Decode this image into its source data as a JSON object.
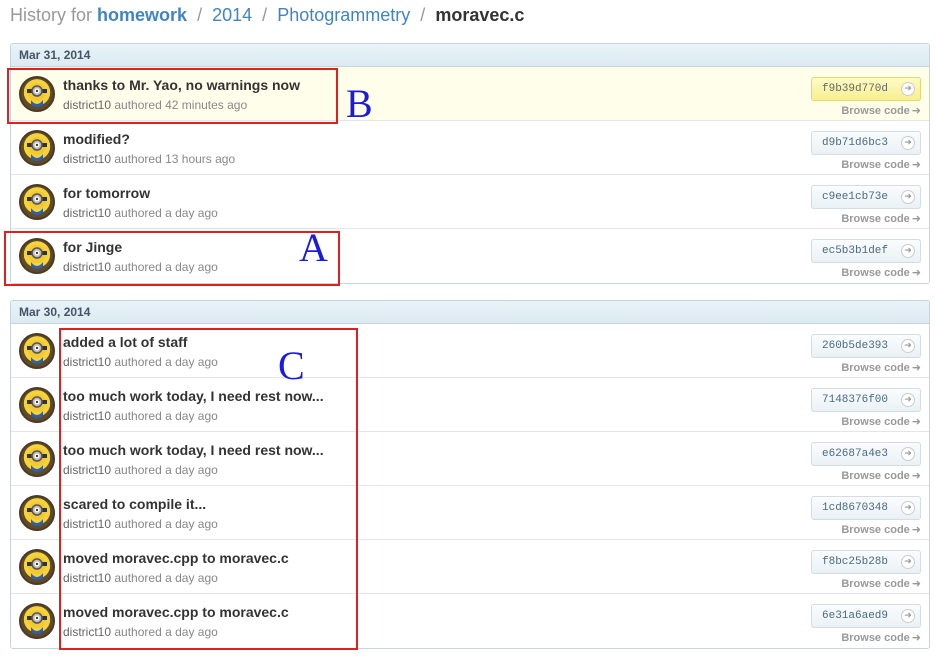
{
  "breadcrumb": {
    "prefix": "History for",
    "repo": "homework",
    "path1": "2014",
    "path2": "Photogrammetry",
    "file": "moravec.c",
    "separator": "/"
  },
  "browse_label": "Browse code",
  "authored_word": "authored",
  "groups": [
    {
      "date": "Mar 31, 2014",
      "commits": [
        {
          "message": "thanks to Mr. Yao, no warnings now",
          "author": "district10",
          "time": "42 minutes ago",
          "sha": "f9b39d770d"
        },
        {
          "message": "modified?",
          "author": "district10",
          "time": "13 hours ago",
          "sha": "d9b71d6bc3"
        },
        {
          "message": "for tomorrow",
          "author": "district10",
          "time": "a day ago",
          "sha": "c9ee1cb73e"
        },
        {
          "message": "for Jinge",
          "author": "district10",
          "time": "a day ago",
          "sha": "ec5b3b1def"
        }
      ]
    },
    {
      "date": "Mar 30, 2014",
      "commits": [
        {
          "message": "added a lot of staff",
          "author": "district10",
          "time": "a day ago",
          "sha": "260b5de393"
        },
        {
          "message": "too much work today, I need rest now...",
          "author": "district10",
          "time": "a day ago",
          "sha": "7148376f00"
        },
        {
          "message": "too much work today, I need rest now...",
          "author": "district10",
          "time": "a day ago",
          "sha": "e62687a4e3"
        },
        {
          "message": "scared to compile it...",
          "author": "district10",
          "time": "a day ago",
          "sha": "1cd8670348"
        },
        {
          "message": "moved moravec.cpp to moravec.c",
          "author": "district10",
          "time": "a day ago",
          "sha": "f8bc25b28b"
        },
        {
          "message": "moved moravec.cpp to moravec.c",
          "author": "district10",
          "time": "a day ago",
          "sha": "6e31a6aed9"
        }
      ]
    }
  ],
  "annotations": {
    "a": "A",
    "b": "B",
    "c": "C"
  },
  "icons": {
    "sha_go": "arrow-circle-icon",
    "browse_arrow": "arrow-right-icon",
    "avatar": "minion-avatar"
  },
  "colors": {
    "link": "#4183c4",
    "annotation_box": "#e02020",
    "annotation_text": "#1a1ae0",
    "highlight_row": "#fffeeb"
  }
}
